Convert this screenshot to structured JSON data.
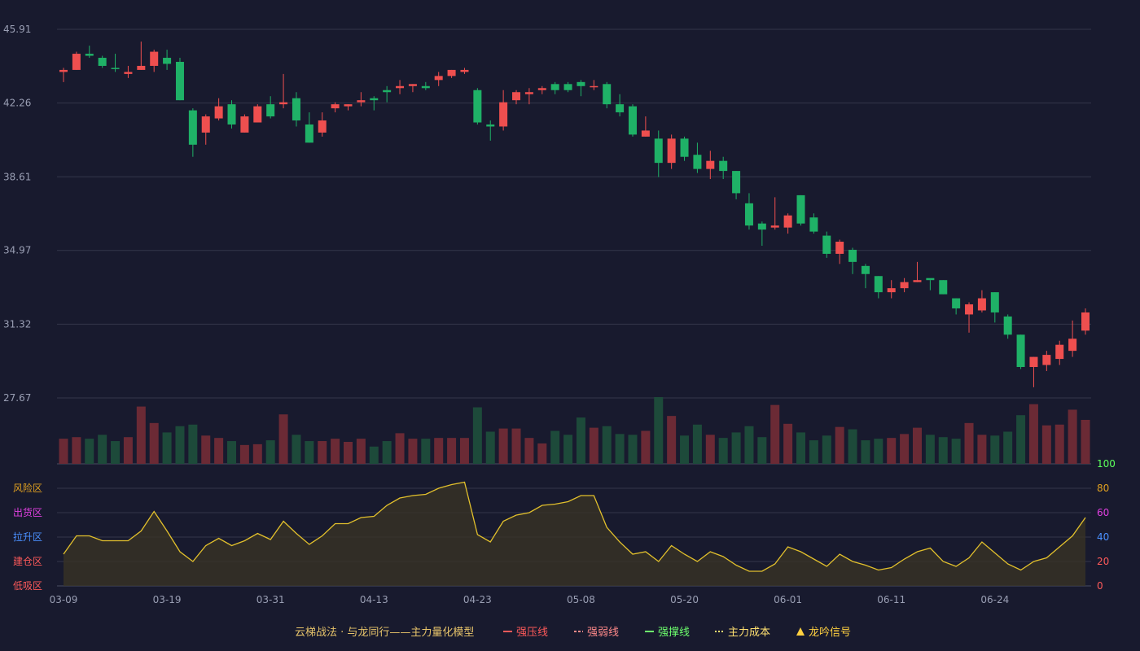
{
  "chart_data": {
    "type": "candlestick",
    "price_axis": {
      "ticks": [
        "45.91",
        "42.26",
        "38.61",
        "34.97",
        "31.32",
        "27.67"
      ],
      "range": [
        27.67,
        45.91
      ]
    },
    "indicator_axis": {
      "ticks": [
        "100",
        "80",
        "60",
        "40",
        "20",
        "0"
      ],
      "range": [
        0,
        100
      ]
    },
    "zone_labels": [
      {
        "text": "风险区",
        "color": "#e0a020"
      },
      {
        "text": "出货区",
        "color": "#e040e0"
      },
      {
        "text": "拉升区",
        "color": "#4a90ff"
      },
      {
        "text": "建仓区",
        "color": "#ff5a5a"
      },
      {
        "text": "低吸区",
        "color": "#ff5a5a"
      }
    ],
    "x_labels": [
      {
        "index": 0,
        "text": "03-09"
      },
      {
        "index": 8,
        "text": "03-19"
      },
      {
        "index": 16,
        "text": "03-31"
      },
      {
        "index": 24,
        "text": "04-13"
      },
      {
        "index": 32,
        "text": "04-23"
      },
      {
        "index": 40,
        "text": "05-08"
      },
      {
        "index": 48,
        "text": "05-20"
      },
      {
        "index": 56,
        "text": "06-01"
      },
      {
        "index": 64,
        "text": "06-11"
      },
      {
        "index": 72,
        "text": "06-24"
      }
    ],
    "candles": [
      [
        43.8,
        43.9,
        44.0,
        43.3
      ],
      [
        43.9,
        44.7,
        44.8,
        43.9
      ],
      [
        44.7,
        44.6,
        45.1,
        44.5
      ],
      [
        44.5,
        44.1,
        44.6,
        44.0
      ],
      [
        44.0,
        43.95,
        44.7,
        43.8
      ],
      [
        43.7,
        43.8,
        44.1,
        43.5
      ],
      [
        43.9,
        44.1,
        45.3,
        43.9
      ],
      [
        44.1,
        44.8,
        44.9,
        43.8
      ],
      [
        44.5,
        44.2,
        44.9,
        43.9
      ],
      [
        44.3,
        42.4,
        44.5,
        42.4
      ],
      [
        41.9,
        40.2,
        42.0,
        39.6
      ],
      [
        40.8,
        41.6,
        41.7,
        40.2
      ],
      [
        41.5,
        42.1,
        42.5,
        41.4
      ],
      [
        42.2,
        41.2,
        42.4,
        41.0
      ],
      [
        40.8,
        41.6,
        41.7,
        40.8
      ],
      [
        41.3,
        42.1,
        42.2,
        41.3
      ],
      [
        42.2,
        41.6,
        42.6,
        41.5
      ],
      [
        42.2,
        42.3,
        43.7,
        42.0
      ],
      [
        42.5,
        41.4,
        42.8,
        41.1
      ],
      [
        41.2,
        40.3,
        41.8,
        40.3
      ],
      [
        40.8,
        41.4,
        41.8,
        40.6
      ],
      [
        42.0,
        42.2,
        42.3,
        41.8
      ],
      [
        42.1,
        42.2,
        42.2,
        41.9
      ],
      [
        42.3,
        42.4,
        42.8,
        42.1
      ],
      [
        42.5,
        42.4,
        42.6,
        41.9
      ],
      [
        42.9,
        42.8,
        43.1,
        42.3
      ],
      [
        43.0,
        43.1,
        43.4,
        42.7
      ],
      [
        43.1,
        43.2,
        43.2,
        42.8
      ],
      [
        43.1,
        43.0,
        43.3,
        42.9
      ],
      [
        43.4,
        43.6,
        43.8,
        43.1
      ],
      [
        43.6,
        43.9,
        43.9,
        43.5
      ],
      [
        43.8,
        43.9,
        44.0,
        43.7
      ],
      [
        42.9,
        41.3,
        43.0,
        41.2
      ],
      [
        41.2,
        41.1,
        41.4,
        40.4
      ],
      [
        41.1,
        42.3,
        42.9,
        40.9
      ],
      [
        42.4,
        42.8,
        42.9,
        42.2
      ],
      [
        42.7,
        42.8,
        43.0,
        42.2
      ],
      [
        42.9,
        43.0,
        43.1,
        42.7
      ],
      [
        43.2,
        42.9,
        43.3,
        42.7
      ],
      [
        43.2,
        42.9,
        43.3,
        42.8
      ],
      [
        43.3,
        43.1,
        43.4,
        42.6
      ],
      [
        43.1,
        43.1,
        43.4,
        42.9
      ],
      [
        43.2,
        42.2,
        43.3,
        42.0
      ],
      [
        42.2,
        41.8,
        42.7,
        41.6
      ],
      [
        42.1,
        40.7,
        42.2,
        40.6
      ],
      [
        40.6,
        40.9,
        41.6,
        40.6
      ],
      [
        40.5,
        39.3,
        40.9,
        38.6
      ],
      [
        39.3,
        40.5,
        40.7,
        39.0
      ],
      [
        40.5,
        39.6,
        40.6,
        39.4
      ],
      [
        39.7,
        39.0,
        40.3,
        38.8
      ],
      [
        39.0,
        39.4,
        39.9,
        38.5
      ],
      [
        39.4,
        38.9,
        39.6,
        38.5
      ],
      [
        38.9,
        37.8,
        38.9,
        37.5
      ],
      [
        37.3,
        36.2,
        37.8,
        36.0
      ],
      [
        36.3,
        36.0,
        36.4,
        35.2
      ],
      [
        36.1,
        36.2,
        37.6,
        36.0
      ],
      [
        36.1,
        36.7,
        36.8,
        35.8
      ],
      [
        37.7,
        36.3,
        37.7,
        36.2
      ],
      [
        36.6,
        35.9,
        36.8,
        35.8
      ],
      [
        35.7,
        34.8,
        35.9,
        34.6
      ],
      [
        34.8,
        35.4,
        35.5,
        34.3
      ],
      [
        35.0,
        34.4,
        35.1,
        33.8
      ],
      [
        34.2,
        33.8,
        34.3,
        33.1
      ],
      [
        33.7,
        32.9,
        33.7,
        32.6
      ],
      [
        32.9,
        33.1,
        33.5,
        32.6
      ],
      [
        33.1,
        33.4,
        33.6,
        32.9
      ],
      [
        33.4,
        33.5,
        34.4,
        33.4
      ],
      [
        33.6,
        33.5,
        33.5,
        33.0
      ],
      [
        33.5,
        32.8,
        33.5,
        32.8
      ],
      [
        32.6,
        32.1,
        32.6,
        31.8
      ],
      [
        31.8,
        32.3,
        32.4,
        30.9
      ],
      [
        32.0,
        32.6,
        33.0,
        31.9
      ],
      [
        32.9,
        31.9,
        32.9,
        31.4
      ],
      [
        31.7,
        30.8,
        31.8,
        30.6
      ],
      [
        30.8,
        29.2,
        30.8,
        29.1
      ],
      [
        29.2,
        29.7,
        29.7,
        28.2
      ],
      [
        29.3,
        29.8,
        30.0,
        29.0
      ],
      [
        29.6,
        30.3,
        30.5,
        29.3
      ],
      [
        30.0,
        30.6,
        31.5,
        29.7
      ],
      [
        31.0,
        31.9,
        32.1,
        30.8
      ]
    ],
    "volume": [
      32,
      34,
      32,
      37,
      29,
      34,
      73,
      52,
      40,
      48,
      50,
      36,
      33,
      29,
      24,
      25,
      30,
      63,
      37,
      29,
      29,
      32,
      28,
      32,
      22,
      29,
      39,
      32,
      32,
      33,
      33,
      33,
      72,
      41,
      45,
      45,
      33,
      26,
      42,
      37,
      59,
      46,
      48,
      38,
      37,
      42,
      85,
      61,
      36,
      50,
      37,
      33,
      40,
      48,
      34,
      75,
      51,
      40,
      30,
      36,
      47,
      44,
      30,
      32,
      33,
      38,
      46,
      37,
      34,
      32,
      52,
      37,
      36,
      41,
      62,
      76,
      49,
      50,
      69,
      56
    ],
    "main_force": [
      26,
      41,
      41,
      37,
      37,
      37,
      45,
      61,
      45,
      28,
      20,
      33,
      39,
      33,
      37,
      43,
      38,
      53,
      43,
      34,
      41,
      51,
      51,
      56,
      57,
      66,
      72,
      74,
      75,
      80,
      83,
      85,
      42,
      36,
      53,
      58,
      60,
      66,
      67,
      69,
      74,
      74,
      48,
      36,
      26,
      28,
      20,
      33,
      26,
      20,
      28,
      24,
      17,
      12,
      12,
      18,
      32,
      28,
      22,
      16,
      26,
      20,
      17,
      13,
      15,
      22,
      28,
      31,
      20,
      16,
      23,
      36,
      27,
      18,
      13,
      20,
      23,
      32,
      41,
      56
    ]
  },
  "legend": [
    {
      "text": "云梯战法 · 与龙同行——主力量化模型",
      "color": "#e6c36a",
      "symbol": ""
    },
    {
      "text": "强压线",
      "color": "#ff5a5a",
      "symbol": "solid"
    },
    {
      "text": "强弱线",
      "color": "#ff8a8a",
      "symbol": "dashed"
    },
    {
      "text": "强撑线",
      "color": "#6dff6d",
      "symbol": "solid"
    },
    {
      "text": "主力成本",
      "color": "#ffe070",
      "symbol": "dotted"
    },
    {
      "text": "龙吟信号",
      "color": "#ffd040",
      "symbol": "triangle"
    }
  ],
  "colors": {
    "up": "#ee4f4f",
    "down": "#1fb167",
    "vol_up": "#6b2a35",
    "vol_down": "#1d4a3a",
    "line": "#e2c02c",
    "grid": "#33364a"
  }
}
